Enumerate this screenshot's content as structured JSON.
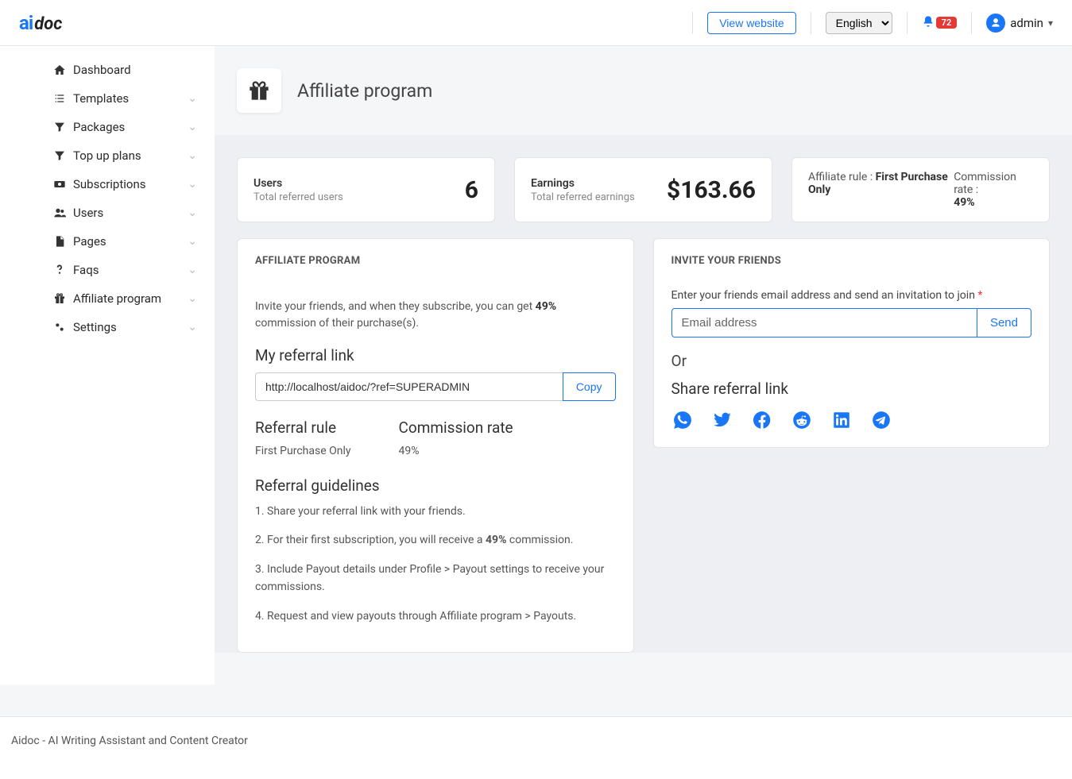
{
  "header": {
    "logo_ai": "ai",
    "logo_doc": "doc",
    "view_website": "View website",
    "language": "English",
    "notif_count": "72",
    "username": "admin"
  },
  "sidebar": {
    "items": [
      {
        "label": "Dashboard",
        "expandable": false
      },
      {
        "label": "Templates",
        "expandable": true
      },
      {
        "label": "Packages",
        "expandable": true
      },
      {
        "label": "Top up plans",
        "expandable": true
      },
      {
        "label": "Subscriptions",
        "expandable": true
      },
      {
        "label": "Users",
        "expandable": true
      },
      {
        "label": "Pages",
        "expandable": true
      },
      {
        "label": "Faqs",
        "expandable": true
      },
      {
        "label": "Affiliate program",
        "expandable": true
      },
      {
        "label": "Settings",
        "expandable": true
      }
    ]
  },
  "page": {
    "title": "Affiliate program"
  },
  "stats": {
    "users_label": "Users",
    "users_sub": "Total referred users",
    "users_value": "6",
    "earnings_label": "Earnings",
    "earnings_sub": "Total referred earnings",
    "earnings_value": "$163.66",
    "rule_label": "Affiliate rule : ",
    "rule_value": "First Purchase Only",
    "commission_label": "Commission rate :",
    "commission_value": "49%"
  },
  "affiliate": {
    "panel_title": "AFFILIATE PROGRAM",
    "desc_pre": "Invite your friends, and when they subscribe, you can get ",
    "desc_pct": "49%",
    "desc_post": " commission of their purchase(s).",
    "referral_link_h": "My referral link",
    "referral_link": "http://localhost/aidoc/?ref=SUPERADMIN",
    "copy": "Copy",
    "rule_h": "Referral rule",
    "rule_v": "First Purchase Only",
    "comm_h": "Commission rate",
    "comm_v": "49%",
    "guidelines_h": "Referral guidelines",
    "g1": "1. Share your referral link with your friends.",
    "g2_pre": "2. For their first subscription, you will receive a ",
    "g2_pct": "49%",
    "g2_post": " commission.",
    "g3": "3. Include Payout details under Profile > Payout settings to receive your commissions.",
    "g4": "4. Request and view payouts through Affiliate program > Payouts."
  },
  "invite": {
    "panel_title": "INVITE YOUR FRIENDS",
    "label": "Enter your friends email address and send an invitation to join ",
    "placeholder": "Email address",
    "send": "Send",
    "or": "Or",
    "share_h": "Share referral link"
  },
  "footer": "Aidoc - AI Writing Assistant and Content Creator"
}
